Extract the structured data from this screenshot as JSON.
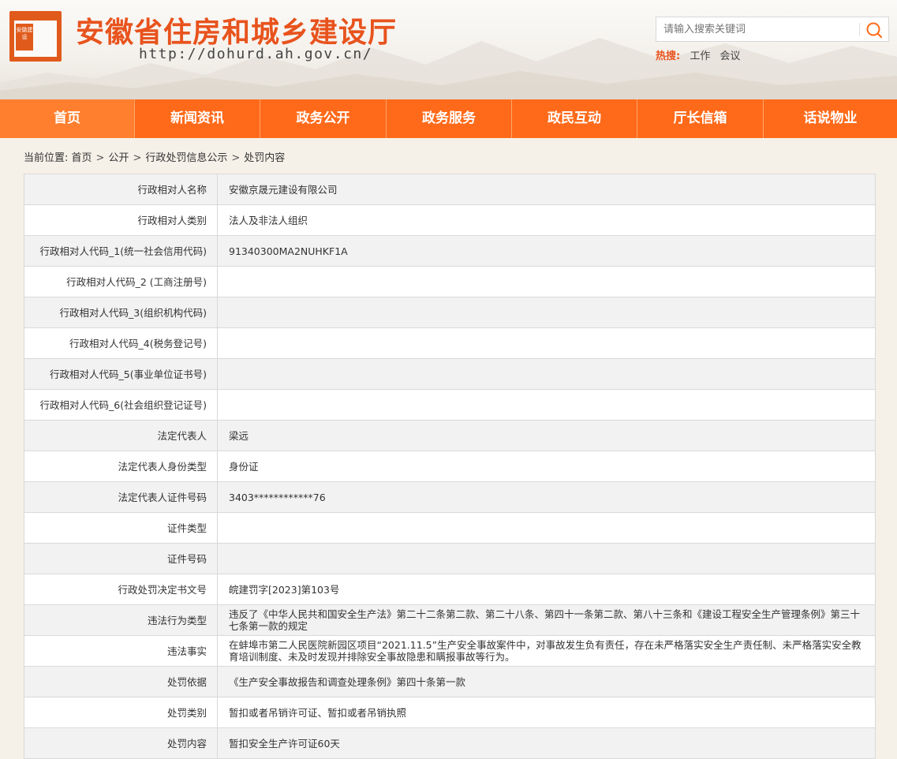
{
  "header": {
    "site_title": "安徽省住房和城乡建设厅",
    "site_url": "http://dohurd.ah.gov.cn/",
    "logo_text": "安徽建设",
    "search_placeholder": "请输入搜索关键词",
    "hot_label": "热搜:",
    "hot_links": [
      "工作",
      "会议"
    ]
  },
  "nav": [
    {
      "label": "首页"
    },
    {
      "label": "新闻资讯"
    },
    {
      "label": "政务公开"
    },
    {
      "label": "政务服务"
    },
    {
      "label": "政民互动"
    },
    {
      "label": "厅长信箱"
    },
    {
      "label": "话说物业"
    }
  ],
  "breadcrumb": {
    "prefix": "当前位置:",
    "items": [
      "首页",
      "公开",
      "行政处罚信息公示",
      "处罚内容"
    ]
  },
  "rows": [
    {
      "key": "行政相对人名称",
      "value": "安徽京晟元建设有限公司"
    },
    {
      "key": "行政相对人类别",
      "value": "法人及非法人组织"
    },
    {
      "key": "行政相对人代码_1(统一社会信用代码)",
      "value": "91340300MA2NUHKF1A"
    },
    {
      "key": "行政相对人代码_2 (工商注册号)",
      "value": ""
    },
    {
      "key": "行政相对人代码_3(组织机构代码)",
      "value": ""
    },
    {
      "key": "行政相对人代码_4(税务登记号)",
      "value": ""
    },
    {
      "key": "行政相对人代码_5(事业单位证书号)",
      "value": ""
    },
    {
      "key": "行政相对人代码_6(社会组织登记证号)",
      "value": ""
    },
    {
      "key": "法定代表人",
      "value": "梁远"
    },
    {
      "key": "法定代表人身份类型",
      "value": "身份证"
    },
    {
      "key": "法定代表人证件号码",
      "value": "3403************76"
    },
    {
      "key": "证件类型",
      "value": ""
    },
    {
      "key": "证件号码",
      "value": ""
    },
    {
      "key": "行政处罚决定书文号",
      "value": "皖建罚字[2023]第103号"
    },
    {
      "key": "违法行为类型",
      "value": "违反了《中华人民共和国安全生产法》第二十二条第二款、第二十八条、第四十一条第二款、第八十三条和《建设工程安全生产管理条例》第三十七条第一款的规定"
    },
    {
      "key": "违法事实",
      "value": "在蚌埠市第二人民医院新园区项目“2021.11.5”生产安全事故案件中，对事故发生负有责任，存在未严格落实安全生产责任制、未严格落实安全教育培训制度、未及时发现并排除安全事故隐患和瞒报事故等行为。"
    },
    {
      "key": "处罚依据",
      "value": "《生产安全事故报告和调查处理条例》第四十条第一款"
    },
    {
      "key": "处罚类别",
      "value": "暂扣或者吊销许可证、暂扣或者吊销执照"
    },
    {
      "key": "处罚内容",
      "value": "暂扣安全生产许可证60天"
    }
  ],
  "colors": {
    "accent": "#ff6a1a",
    "title": "#e8531d"
  },
  "icons": {
    "search": "search-icon",
    "logo": "logo-icon"
  }
}
